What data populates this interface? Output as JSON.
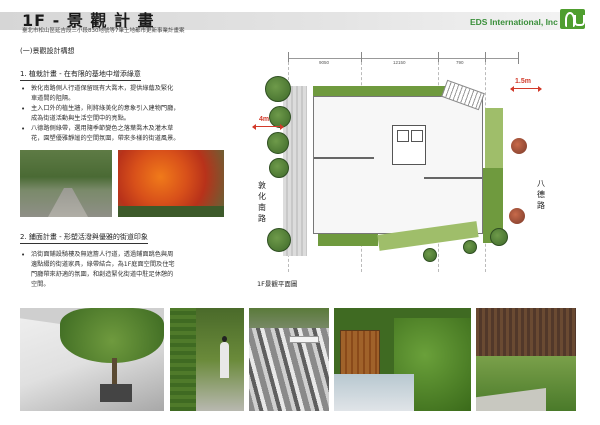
{
  "header": {
    "title": "1F - 景 觀 計 畫",
    "subtitle": "臺北市松山區延吉段三小段830地號等7筆土地都市更新事業計畫案",
    "company": "EDS International, Inc",
    "logo_icon": "eds-logo-mark"
  },
  "section": {
    "heading": "(一)景觀設計構想",
    "planting": {
      "title": "1. 植栽計畫 - 在有限的基地中增添綠意",
      "bullets": [
        [
          "敦化南路側人行道保留既有大喬木，提供綠蔭及緊化",
          "車道間的阻隔。"
        ],
        [
          "主入口外的植生牆，則將綠美化的意象引入建物門廳，",
          "成為街道活動與生活空間中的亮點。"
        ],
        [
          "八德路側綠帶，選用隨季節變色之落葉喬木及灌木草",
          "花，園塑優雅靜謐的空間氛圍，帶來多樣的街道風景。"
        ]
      ]
    },
    "paving": {
      "title": "2. 鋪面計畫 - 形塑活潑與優雅的街道印象",
      "bullets": [
        [
          "沿街面鋪設騎樓及無遮簷人行道，透過鋪面跳色與周",
          "邊點綴的街道家具，綠帶結合，為1F庭面空間及住宅",
          "門廳帶來舒適的氛圍，和創造緊化街道中駐足休憩的",
          "空間。"
        ]
      ]
    }
  },
  "plan": {
    "caption": "1F景觀平面圖",
    "dims": [
      "9050",
      "12150",
      "790"
    ],
    "red_dims": [
      "1.5m",
      "4m"
    ],
    "street_left": [
      "敦",
      "化",
      "南",
      "路"
    ],
    "street_right": [
      "八",
      "德",
      "路"
    ]
  },
  "colors": {
    "accent_green": "#4f9e2f",
    "dim_red": "#d23a2a"
  }
}
